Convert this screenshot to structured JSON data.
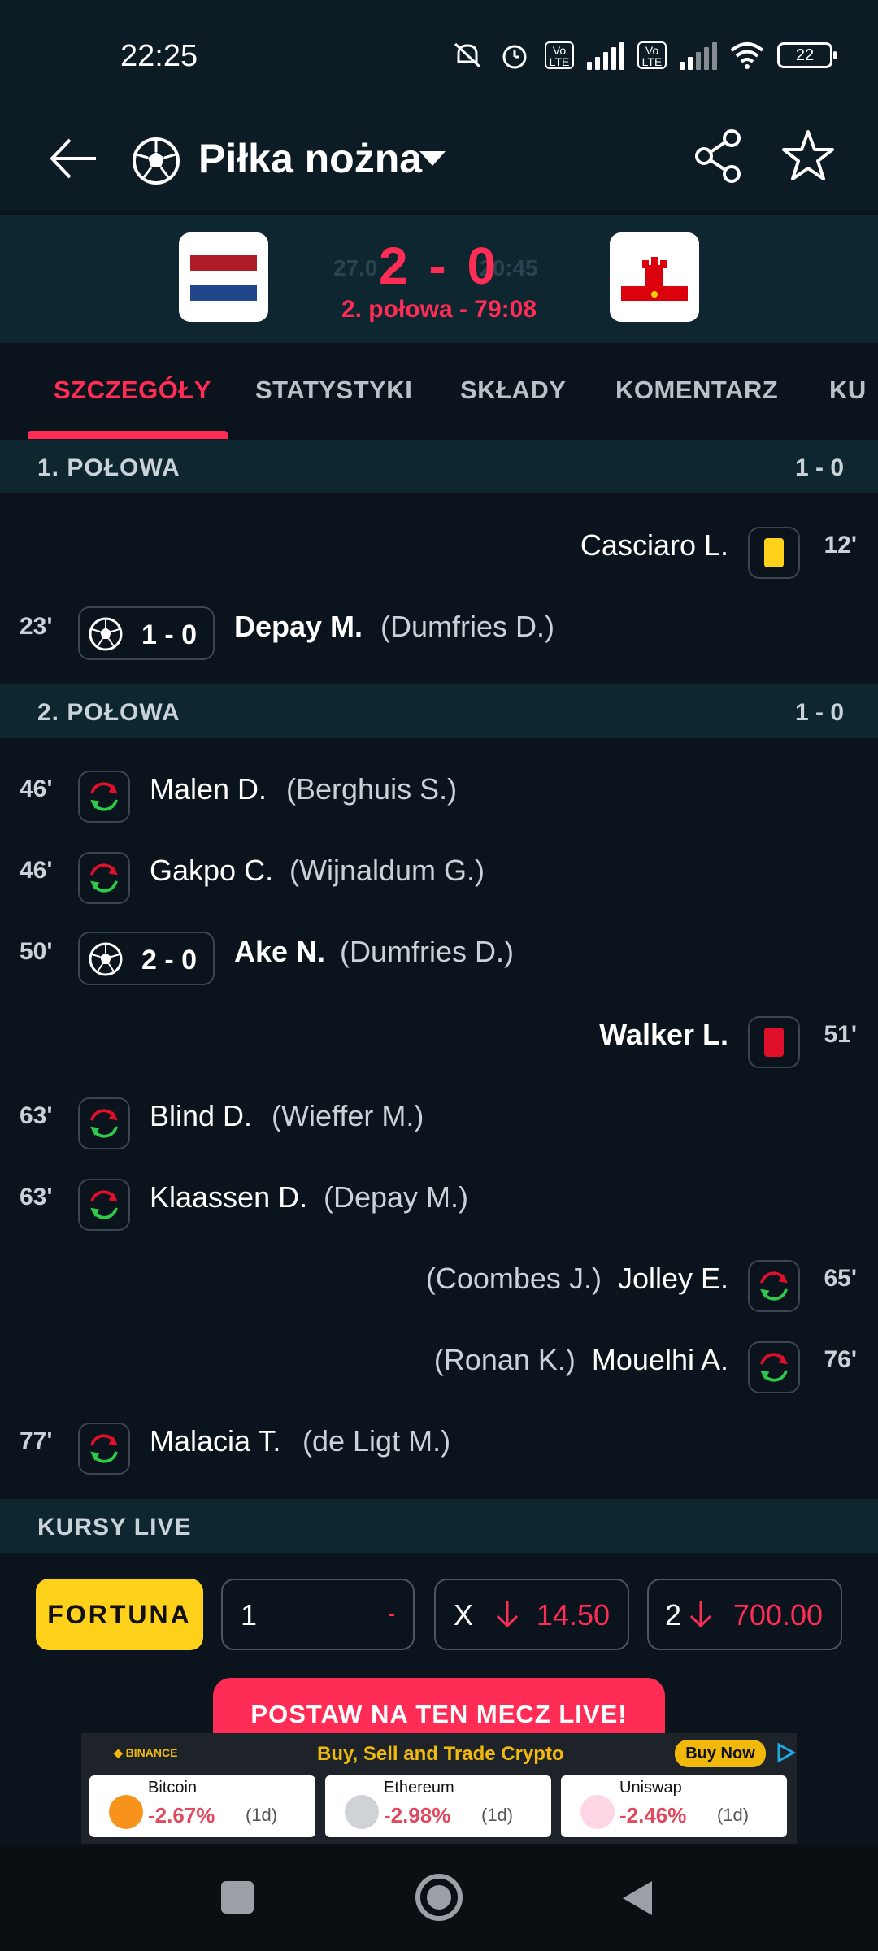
{
  "status_bar": {
    "time": "22:25",
    "battery": "22"
  },
  "header": {
    "title": "Piłka nożna"
  },
  "match": {
    "score": "2 - 0",
    "date_faded": "27.0",
    "time_faded": "20:45",
    "period": "2. połowa - 79:08"
  },
  "tabs": [
    {
      "label": "SZCZEGÓŁY"
    },
    {
      "label": "STATYSTYKI"
    },
    {
      "label": "SKŁADY"
    },
    {
      "label": "KOMENTARZ"
    },
    {
      "label": "KU"
    }
  ],
  "sections": {
    "first_half": {
      "title": "1. POŁOWA",
      "result": "1 - 0"
    },
    "second_half": {
      "title": "2. POŁOWA",
      "result": "1 - 0"
    },
    "odds": {
      "title": "KURSY LIVE"
    }
  },
  "events": {
    "e1": {
      "minute": "12'",
      "player": "Casciaro L."
    },
    "e2": {
      "minute": "23'",
      "score": "1 - 0",
      "player": "Depay M.",
      "assist": "(Dumfries D.)"
    },
    "e3": {
      "minute": "46'",
      "player": "Malen D.",
      "assist": "(Berghuis S.)"
    },
    "e4": {
      "minute": "46'",
      "player": "Gakpo C.",
      "assist": "(Wijnaldum G.)"
    },
    "e5": {
      "minute": "50'",
      "score": "2 - 0",
      "player": "Ake N.",
      "assist": "(Dumfries D.)"
    },
    "e6": {
      "minute": "51'",
      "player": "Walker L."
    },
    "e7": {
      "minute": "63'",
      "player": "Blind D.",
      "assist": "(Wieffer M.)"
    },
    "e8": {
      "minute": "63'",
      "player": "Klaassen D.",
      "assist": "(Depay M.)"
    },
    "e9": {
      "minute": "65'",
      "player": "Jolley E.",
      "assist": "(Coombes J.)"
    },
    "e10": {
      "minute": "76'",
      "player": "Mouelhi A.",
      "assist": "(Ronan K.)"
    },
    "e11": {
      "minute": "77'",
      "player": "Malacia T.",
      "assist": "(de Ligt M.)"
    }
  },
  "odds": {
    "bookmaker": "FORTUNA",
    "home": {
      "label": "1",
      "value": "-"
    },
    "draw": {
      "label": "X",
      "value": "14.50"
    },
    "away": {
      "label": "2",
      "value": "700.00"
    },
    "cta": "POSTAW NA TEN MECZ LIVE!"
  },
  "ad": {
    "brand": "BINANCE",
    "tagline": "Buy, Sell and Trade Crypto",
    "button": "Buy Now",
    "coins": [
      {
        "name": "Bitcoin",
        "change": "-2.67%",
        "period": "(1d)"
      },
      {
        "name": "Ethereum",
        "change": "-2.98%",
        "period": "(1d)"
      },
      {
        "name": "Uniswap",
        "change": "-2.46%",
        "period": "(1d)"
      }
    ]
  },
  "colors": {
    "accent": "#ff2d55",
    "background": "#0b141c",
    "section": "#0e2630",
    "yellow_card": "#ffd11a",
    "red_card": "#e0102a"
  },
  "icons": [
    "back-arrow-icon",
    "soccer-ball-icon",
    "chevron-down-icon",
    "share-icon",
    "star-icon",
    "substitution-icon",
    "yellow-card-icon",
    "red-card-icon",
    "arrow-down-icon"
  ]
}
